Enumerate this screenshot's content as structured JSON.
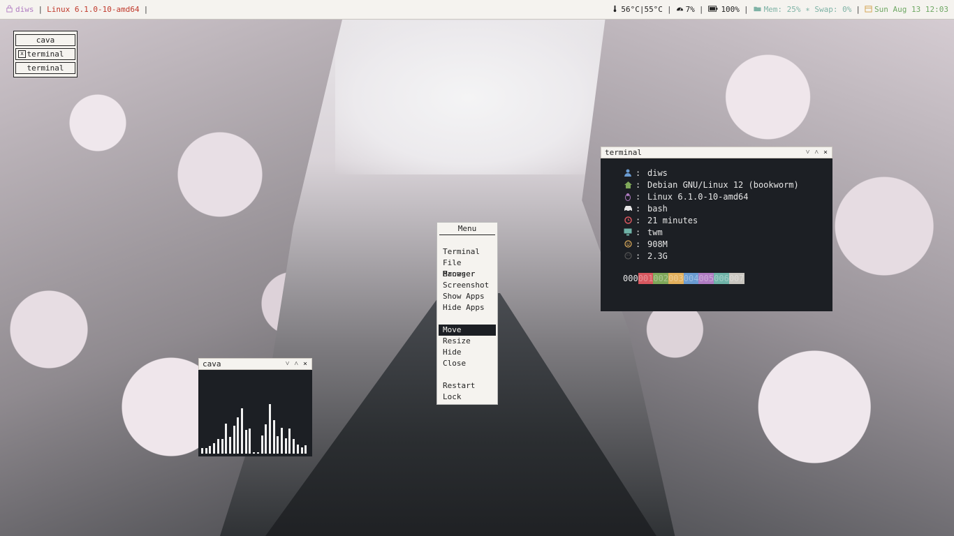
{
  "topbar": {
    "user": "diws",
    "kernel": "Linux 6.1.0-10-amd64",
    "temp": "56°C|55°C",
    "cpu": "7%",
    "battery": "100%",
    "mem": "Mem: 25% ∗ Swap: 0%",
    "datetime": "Sun Aug 13 12:03",
    "sep": "|"
  },
  "window_list": {
    "items": [
      {
        "label": "cava"
      },
      {
        "label": "terminal",
        "close_glyph": "x"
      },
      {
        "label": "terminal"
      }
    ]
  },
  "terminal_window": {
    "title": "terminal",
    "buttons": [
      "˅",
      "˄",
      "×"
    ],
    "rows": [
      {
        "icon": "user-icon",
        "colon": ":",
        "value": "diws"
      },
      {
        "icon": "home-icon",
        "colon": ":",
        "value": "Debian GNU/Linux 12 (bookworm)"
      },
      {
        "icon": "linux-icon",
        "colon": ":",
        "value": "Linux 6.1.0-10-amd64"
      },
      {
        "icon": "car-icon",
        "colon": ":",
        "value": "bash"
      },
      {
        "icon": "history-icon",
        "colon": ":",
        "value": "21 minutes"
      },
      {
        "icon": "monitor-icon",
        "colon": ":",
        "value": "twm"
      },
      {
        "icon": "smile-icon",
        "colon": ":",
        "value": "908M"
      },
      {
        "icon": "face-icon",
        "colon": ":",
        "value": "2.3G"
      }
    ],
    "color_blocks": [
      {
        "text": "000",
        "bg": "transparent",
        "fg": "#e6e6e6"
      },
      {
        "text": "001",
        "bg": "#d8575f",
        "fg": "#d8575f"
      },
      {
        "text": "002",
        "bg": "#7fa85a",
        "fg": "#7fa85a"
      },
      {
        "text": "003",
        "bg": "#e3b05c",
        "fg": "#e3b05c"
      },
      {
        "text": "004",
        "bg": "#6a9bd1",
        "fg": "#6a9bd1"
      },
      {
        "text": "005",
        "bg": "#b07cc2",
        "fg": "#b07cc2"
      },
      {
        "text": "006",
        "bg": "#6fb3a8",
        "fg": "#6fb3a8"
      },
      {
        "text": "007",
        "bg": "#c9c6c0",
        "fg": "#c9c6c0"
      }
    ]
  },
  "cava_window": {
    "title": "cava",
    "buttons": [
      "˅",
      "˄",
      "×"
    ],
    "levels": [
      0.07,
      0.07,
      0.1,
      0.14,
      0.19,
      0.19,
      0.39,
      0.22,
      0.36,
      0.47,
      0.59,
      0.31,
      0.33,
      0.02,
      0.02,
      0.24,
      0.38,
      0.65,
      0.44,
      0.23,
      0.34,
      0.2,
      0.33,
      0.19,
      0.12,
      0.08,
      0.11
    ]
  },
  "menu": {
    "title": "Menu",
    "groups": [
      [
        "Terminal",
        "File Manager",
        "Browser",
        "Screenshot",
        "Show Apps",
        "Hide Apps"
      ],
      [
        "Move",
        "Resize",
        "Hide",
        "Close"
      ],
      [
        "Restart",
        "Lock"
      ]
    ],
    "selected": "Move"
  },
  "colors": {
    "accent_purple": "#b07cc2",
    "accent_red": "#c0392b",
    "accent_teal": "#7fb3a6",
    "terminal_bg": "#1c1f24"
  }
}
